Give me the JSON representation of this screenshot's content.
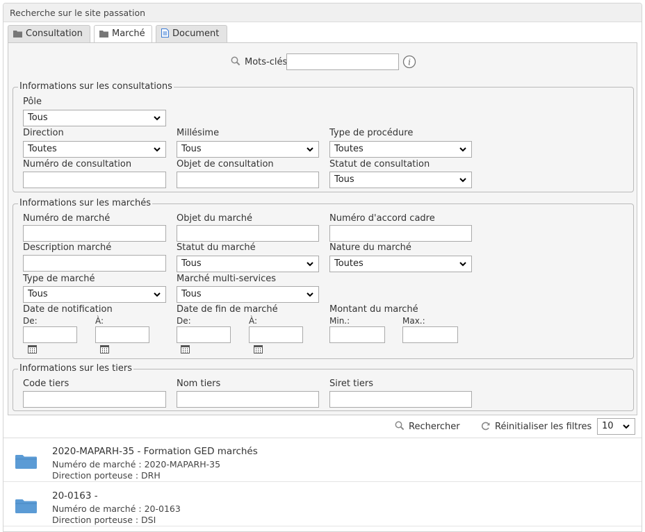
{
  "panel": {
    "title": "Recherche sur le site passation"
  },
  "tabs": [
    {
      "label": "Consultation"
    },
    {
      "label": "Marché"
    },
    {
      "label": "Document"
    }
  ],
  "keywords": {
    "label": "Mots-clés",
    "value": ""
  },
  "consultations": {
    "legend": "Informations sur les consultations",
    "pole": {
      "label": "Pôle",
      "value": "Tous"
    },
    "direction": {
      "label": "Direction",
      "value": "Toutes"
    },
    "millesime": {
      "label": "Millésime",
      "value": "Tous"
    },
    "type_procedure": {
      "label": "Type de procédure",
      "value": "Toutes"
    },
    "numero": {
      "label": "Numéro de consultation",
      "value": ""
    },
    "objet": {
      "label": "Objet de consultation",
      "value": ""
    },
    "statut": {
      "label": "Statut de consultation",
      "value": "Tous"
    }
  },
  "marches": {
    "legend": "Informations sur les marchés",
    "numero": {
      "label": "Numéro de marché",
      "value": ""
    },
    "objet": {
      "label": "Objet du marché",
      "value": ""
    },
    "accord_cadre": {
      "label": "Numéro d'accord cadre",
      "value": ""
    },
    "description": {
      "label": "Description marché",
      "value": ""
    },
    "statut": {
      "label": "Statut du marché",
      "value": "Tous"
    },
    "nature": {
      "label": "Nature du marché",
      "value": "Toutes"
    },
    "type": {
      "label": "Type de marché",
      "value": "Tous"
    },
    "multi_services": {
      "label": "Marché multi-services",
      "value": "Tous"
    },
    "date_notification": {
      "label": "Date de notification",
      "from": "De:",
      "to": "À:"
    },
    "date_fin": {
      "label": "Date de fin de marché",
      "from": "De:",
      "to": "À:"
    },
    "montant": {
      "label": "Montant du marché",
      "min": "Min.:",
      "max": "Max.:"
    }
  },
  "tiers": {
    "legend": "Informations sur les tiers",
    "code": {
      "label": "Code tiers",
      "value": ""
    },
    "nom": {
      "label": "Nom tiers",
      "value": ""
    },
    "siret": {
      "label": "Siret tiers",
      "value": ""
    }
  },
  "toolbar": {
    "search_label": "Rechercher",
    "reset_label": "Réinitialiser les filtres",
    "page_size": "10"
  },
  "results": [
    {
      "title": "2020-MAPARH-35 - Formation GED marchés",
      "numero": "Numéro de marché : 2020-MAPARH-35",
      "direction": "Direction porteuse : DRH"
    },
    {
      "title": "20-0163 -",
      "numero": "Numéro de marché : 20-0163",
      "direction": "Direction porteuse : DSI"
    }
  ],
  "colors": {
    "folder": "#5b9bd5",
    "tab_inactive": "#e4e4e4",
    "form_bg": "#f5f5f5"
  },
  "icons": [
    "folder-icon",
    "document-icon",
    "search-icon",
    "info-icon",
    "calendar-icon",
    "refresh-icon",
    "chevron-down-icon"
  ]
}
